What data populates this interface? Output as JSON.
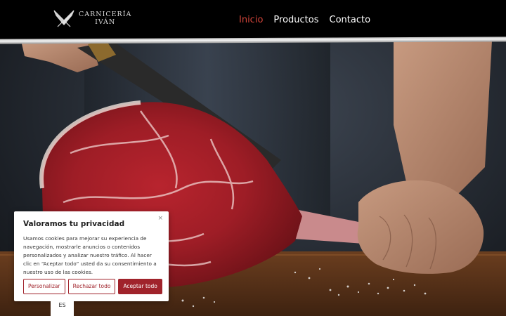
{
  "header": {
    "logo": {
      "line1": "CARNICERÍA",
      "line2": "IVÁN"
    },
    "nav": [
      {
        "label": "Inicio",
        "active": true
      },
      {
        "label": "Productos",
        "active": false
      },
      {
        "label": "Contacto",
        "active": false
      }
    ]
  },
  "hero": {
    "image": "butcher-hand-holding-tomahawk-steak-on-wooden-board"
  },
  "cookie_banner": {
    "close_icon": "×",
    "title": "Valoramos tu privacidad",
    "body": "Usamos cookies para mejorar su experiencia de navegación, mostrarle anuncios o contenidos personalizados y analizar nuestro tráfico. Al hacer clic en “Aceptar todo” usted da su consentimiento a nuestro uso de las cookies.",
    "buttons": {
      "customize": "Personalizar",
      "reject": "Rechazar todo",
      "accept": "Aceptar todo"
    }
  },
  "language": "ES",
  "colors": {
    "accent": "#a0232b",
    "nav_active": "#d2453a",
    "header_bg": "#000000"
  }
}
